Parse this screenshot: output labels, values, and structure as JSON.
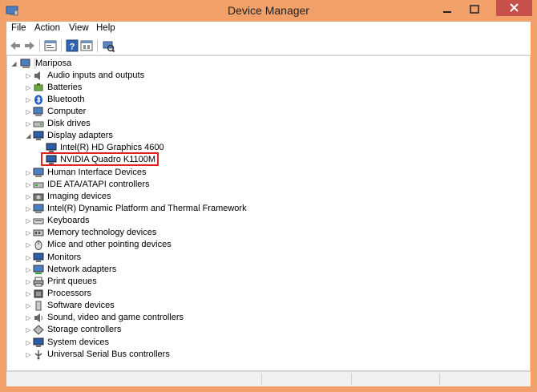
{
  "window": {
    "title": "Device Manager"
  },
  "menu": [
    "File",
    "Action",
    "View",
    "Help"
  ],
  "toolbar": {
    "icons": [
      "back-arrow-icon",
      "forward-arrow-icon",
      "properties-icon",
      "help-icon",
      "show-hidden-icon",
      "scan-hardware-icon"
    ]
  },
  "tree": {
    "root": "Mariposa",
    "categories": [
      {
        "label": "Audio inputs and outputs",
        "icon": "speaker-icon",
        "expanded": false
      },
      {
        "label": "Batteries",
        "icon": "battery-icon",
        "expanded": false
      },
      {
        "label": "Bluetooth",
        "icon": "bluetooth-icon",
        "expanded": false
      },
      {
        "label": "Computer",
        "icon": "computer-icon",
        "expanded": false
      },
      {
        "label": "Disk drives",
        "icon": "disk-icon",
        "expanded": false
      },
      {
        "label": "Display adapters",
        "icon": "monitor-icon",
        "expanded": true,
        "children": [
          "Intel(R) HD Graphics 4600",
          "NVIDIA Quadro K1100M"
        ]
      },
      {
        "label": "Human Interface Devices",
        "icon": "hid-icon",
        "expanded": false
      },
      {
        "label": "IDE ATA/ATAPI controllers",
        "icon": "ide-icon",
        "expanded": false
      },
      {
        "label": "Imaging devices",
        "icon": "camera-icon",
        "expanded": false
      },
      {
        "label": "Intel(R) Dynamic Platform and Thermal Framework",
        "icon": "chip-icon",
        "expanded": false
      },
      {
        "label": "Keyboards",
        "icon": "keyboard-icon",
        "expanded": false
      },
      {
        "label": "Memory technology devices",
        "icon": "memory-icon",
        "expanded": false
      },
      {
        "label": "Mice and other pointing devices",
        "icon": "mouse-icon",
        "expanded": false
      },
      {
        "label": "Monitors",
        "icon": "monitor-icon",
        "expanded": false
      },
      {
        "label": "Network adapters",
        "icon": "network-icon",
        "expanded": false
      },
      {
        "label": "Print queues",
        "icon": "printer-icon",
        "expanded": false
      },
      {
        "label": "Processors",
        "icon": "processor-icon",
        "expanded": false
      },
      {
        "label": "Software devices",
        "icon": "software-icon",
        "expanded": false
      },
      {
        "label": "Sound, video and game controllers",
        "icon": "sound-icon",
        "expanded": false
      },
      {
        "label": "Storage controllers",
        "icon": "storage-icon",
        "expanded": false
      },
      {
        "label": "System devices",
        "icon": "system-icon",
        "expanded": false
      },
      {
        "label": "Universal Serial Bus controllers",
        "icon": "usb-icon",
        "expanded": false
      }
    ],
    "highlighted_child": "NVIDIA Quadro K1100M"
  },
  "colors": {
    "frame": "#f1a06a",
    "close": "#c7504a",
    "highlight_border": "#e02323"
  }
}
